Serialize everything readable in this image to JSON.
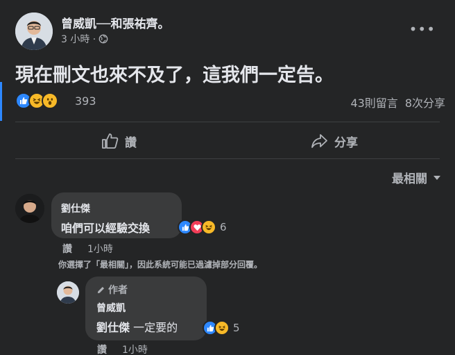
{
  "post": {
    "author": "曾威凱──和張祐齊。",
    "time": "3 小時 ·",
    "text": "現在刪文也來不及了，這我們一定告。",
    "reaction_count": "393",
    "comments_count": "43則留言",
    "shares_count": "8次分享",
    "reaction_icons": [
      "like-icon",
      "haha-icon",
      "wow-icon"
    ]
  },
  "actions": {
    "like_label": "讚",
    "share_label": "分享"
  },
  "sort": {
    "label": "最相關"
  },
  "comments": [
    {
      "author": "劉仕傑",
      "text": "咱們可以經驗交換",
      "reaction_count": "6",
      "reaction_icons": [
        "like-icon",
        "love-icon",
        "haha-icon"
      ],
      "like_label": "讚",
      "time": "1小時"
    }
  ],
  "filter_note": "你選擇了「最相關」，因此系統可能已過濾掉部分回覆。",
  "reply": {
    "badge": "作者",
    "author": "曾威凱",
    "mention": "劉仕傑",
    "text": " 一定要的",
    "reaction_count": "5",
    "reaction_icons": [
      "like-icon",
      "haha-icon"
    ],
    "like_label": "讚",
    "time": "1小時"
  },
  "colors": {
    "background": "#242526",
    "bubble": "#3a3b3c",
    "primary_text": "#e4e6eb",
    "secondary_text": "#b0b3b8",
    "accent": "#2d88ff"
  }
}
